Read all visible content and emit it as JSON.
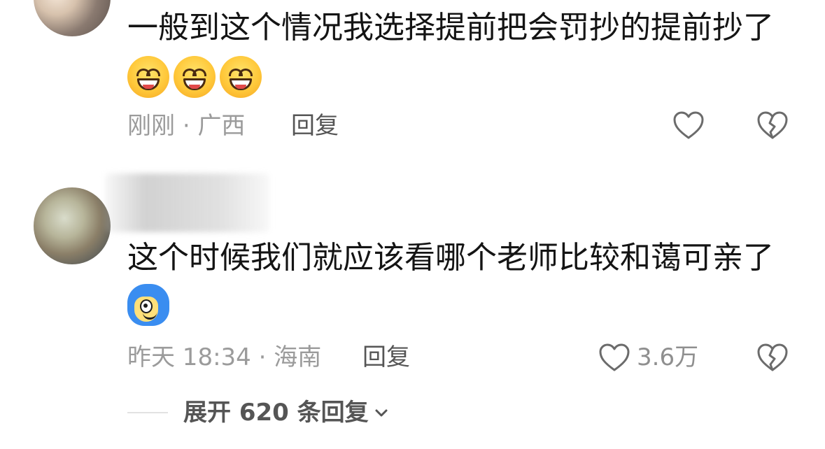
{
  "comments": [
    {
      "text": "一般到这个情况我选择提前把会罚抄的提前抄了",
      "emojis": [
        "grinning-emoji",
        "grinning-emoji",
        "grinning-emoji"
      ],
      "time": "刚刚",
      "separator": "·",
      "location": "广西",
      "reply_label": "回复",
      "like_icon": "heart-outline-icon",
      "dislike_icon": "broken-heart-icon"
    },
    {
      "text": "这个时候我们就应该看哪个老师比较和蔼可亲了",
      "emojis": [
        "blue-monster-emoji"
      ],
      "time": "昨天 18:34",
      "separator": "·",
      "location": "海南",
      "reply_label": "回复",
      "like_count": "3.6万",
      "like_icon": "heart-outline-icon",
      "dislike_icon": "broken-heart-icon"
    }
  ],
  "expand": {
    "label": "展开 620 条回复",
    "icon": "chevron-down-icon"
  },
  "colors": {
    "text": "#141414",
    "meta": "#9b9b9b",
    "reply": "#555555",
    "icon": "#6b6b6b"
  }
}
